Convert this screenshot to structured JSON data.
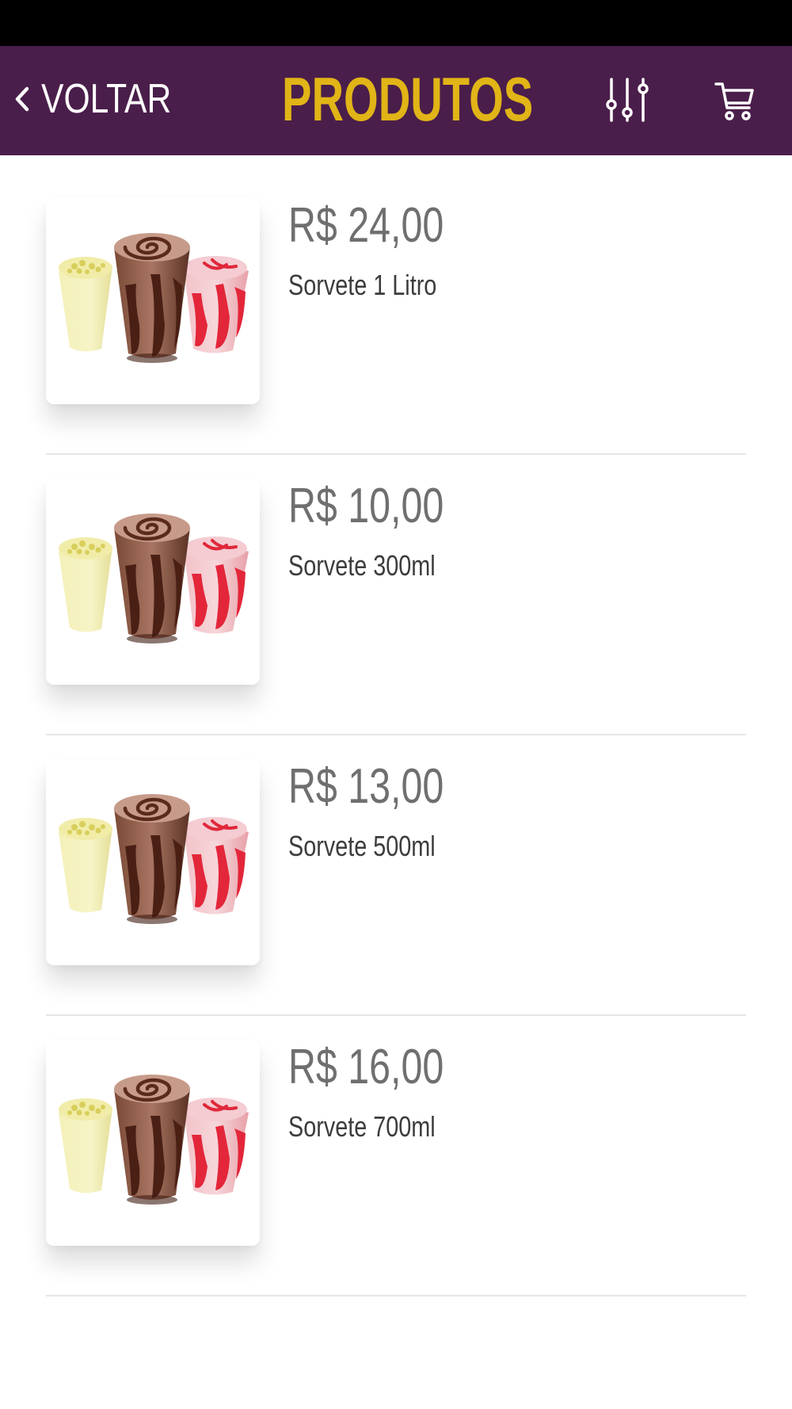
{
  "header": {
    "back_label": "VOLTAR",
    "title": "PRODUTOS",
    "filter_icon": "sliders-icon",
    "cart_icon": "cart-icon"
  },
  "colors": {
    "header_background": "#4a1e4a",
    "title": "#e1b417",
    "status_bar": "#000000",
    "price": "#6f6f6f",
    "name": "#3c3c3c"
  },
  "products": [
    {
      "price": "R$ 24,00",
      "name": "Sorvete 1 Litro",
      "image": "ice-cream-cups-image"
    },
    {
      "price": "R$ 10,00",
      "name": "Sorvete 300ml",
      "image": "ice-cream-cups-image"
    },
    {
      "price": "R$ 13,00",
      "name": "Sorvete 500ml",
      "image": "ice-cream-cups-image"
    },
    {
      "price": "R$ 16,00",
      "name": "Sorvete 700ml",
      "image": "ice-cream-cups-image"
    }
  ]
}
